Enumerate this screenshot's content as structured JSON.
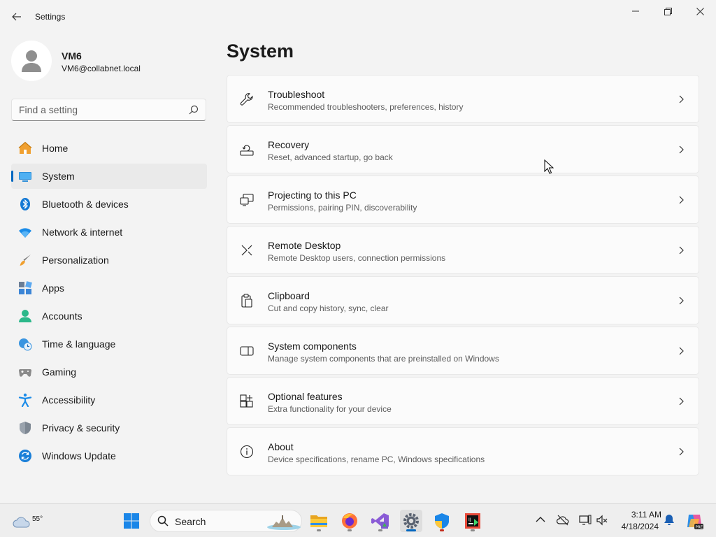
{
  "window": {
    "title": "Settings"
  },
  "profile": {
    "name": "VM6",
    "email": "VM6@collabnet.local"
  },
  "search": {
    "placeholder": "Find a setting"
  },
  "sidebar": {
    "items": [
      {
        "label": "Home",
        "icon": "home-icon",
        "selected": false
      },
      {
        "label": "System",
        "icon": "system-icon",
        "selected": true
      },
      {
        "label": "Bluetooth & devices",
        "icon": "bluetooth-icon",
        "selected": false
      },
      {
        "label": "Network & internet",
        "icon": "wifi-icon",
        "selected": false
      },
      {
        "label": "Personalization",
        "icon": "brush-icon",
        "selected": false
      },
      {
        "label": "Apps",
        "icon": "apps-icon",
        "selected": false
      },
      {
        "label": "Accounts",
        "icon": "accounts-icon",
        "selected": false
      },
      {
        "label": "Time & language",
        "icon": "globe-clock-icon",
        "selected": false
      },
      {
        "label": "Gaming",
        "icon": "gamepad-icon",
        "selected": false
      },
      {
        "label": "Accessibility",
        "icon": "accessibility-icon",
        "selected": false
      },
      {
        "label": "Privacy & security",
        "icon": "shield-icon",
        "selected": false
      },
      {
        "label": "Windows Update",
        "icon": "update-icon",
        "selected": false
      }
    ]
  },
  "main": {
    "title": "System",
    "cards": [
      {
        "title": "Troubleshoot",
        "desc": "Recommended troubleshooters, preferences, history",
        "icon": "wrench-icon"
      },
      {
        "title": "Recovery",
        "desc": "Reset, advanced startup, go back",
        "icon": "recovery-icon"
      },
      {
        "title": "Projecting to this PC",
        "desc": "Permissions, pairing PIN, discoverability",
        "icon": "projector-icon"
      },
      {
        "title": "Remote Desktop",
        "desc": "Remote Desktop users, connection permissions",
        "icon": "remote-desktop-icon"
      },
      {
        "title": "Clipboard",
        "desc": "Cut and copy history, sync, clear",
        "icon": "clipboard-icon"
      },
      {
        "title": "System components",
        "desc": "Manage system components that are preinstalled on Windows",
        "icon": "components-icon"
      },
      {
        "title": "Optional features",
        "desc": "Extra functionality for your device",
        "icon": "optional-features-icon"
      },
      {
        "title": "About",
        "desc": "Device specifications, rename PC, Windows specifications",
        "icon": "info-icon"
      }
    ]
  },
  "taskbar": {
    "weather_temp": "55°",
    "search_label": "Search",
    "clock_time": "3:11 AM",
    "clock_date": "4/18/2024",
    "apps": [
      "start-icon",
      "file-explorer-icon",
      "firefox-icon",
      "visual-studio-icon",
      "settings-icon",
      "security-shield-icon",
      "jetbrains-icon"
    ]
  },
  "colors": {
    "accent": "#0067c0",
    "background": "#f3f3f3",
    "card": "#fbfbfb"
  }
}
